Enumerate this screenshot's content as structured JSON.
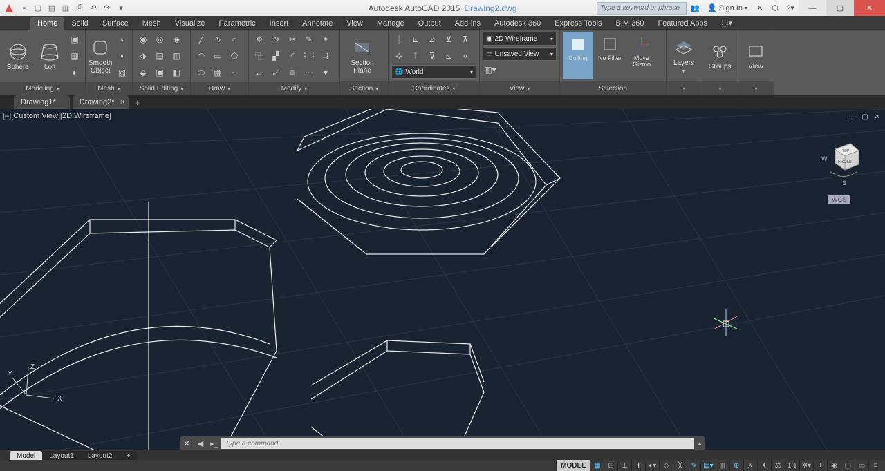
{
  "app": {
    "name": "Autodesk AutoCAD 2015",
    "doc": "Drawing2.dwg"
  },
  "search": {
    "placeholder": "Type a keyword or phrase"
  },
  "signin": {
    "label": "Sign In"
  },
  "tabs": [
    "Home",
    "Solid",
    "Surface",
    "Mesh",
    "Visualize",
    "Parametric",
    "Insert",
    "Annotate",
    "View",
    "Manage",
    "Output",
    "Add-ins",
    "Autodesk 360",
    "Express Tools",
    "BIM 360",
    "Featured Apps"
  ],
  "ribbon": {
    "modeling": {
      "title": "Modeling",
      "sphere": "Sphere",
      "loft": "Loft",
      "smooth": "Smooth\nObject"
    },
    "mesh": {
      "title": "Mesh"
    },
    "solid_editing": {
      "title": "Solid Editing"
    },
    "draw": {
      "title": "Draw"
    },
    "modify": {
      "title": "Modify"
    },
    "section": {
      "title": "Section",
      "plane": "Section\nPlane"
    },
    "coordinates": {
      "title": "Coordinates",
      "world": "World"
    },
    "view": {
      "title": "View",
      "style": "2D Wireframe",
      "saved": "Unsaved View"
    },
    "selection": {
      "title": "Selection",
      "culling": "Culling",
      "nofilter": "No Filter",
      "gizmo": "Move\nGizmo"
    },
    "layers": {
      "title": "Layers"
    },
    "groups": {
      "title": "Groups"
    },
    "viewpanel": {
      "title": "View"
    }
  },
  "doctabs": {
    "t1": "Drawing1*",
    "t2": "Drawing2*"
  },
  "viewport": {
    "label": "[–][Custom View][2D Wireframe]",
    "wcs": "WCS"
  },
  "cmd": {
    "placeholder": "Type a command"
  },
  "layout": {
    "model": "Model",
    "l1": "Layout1",
    "l2": "Layout2"
  },
  "status": {
    "model": "MODEL",
    "scale": "1:1"
  }
}
